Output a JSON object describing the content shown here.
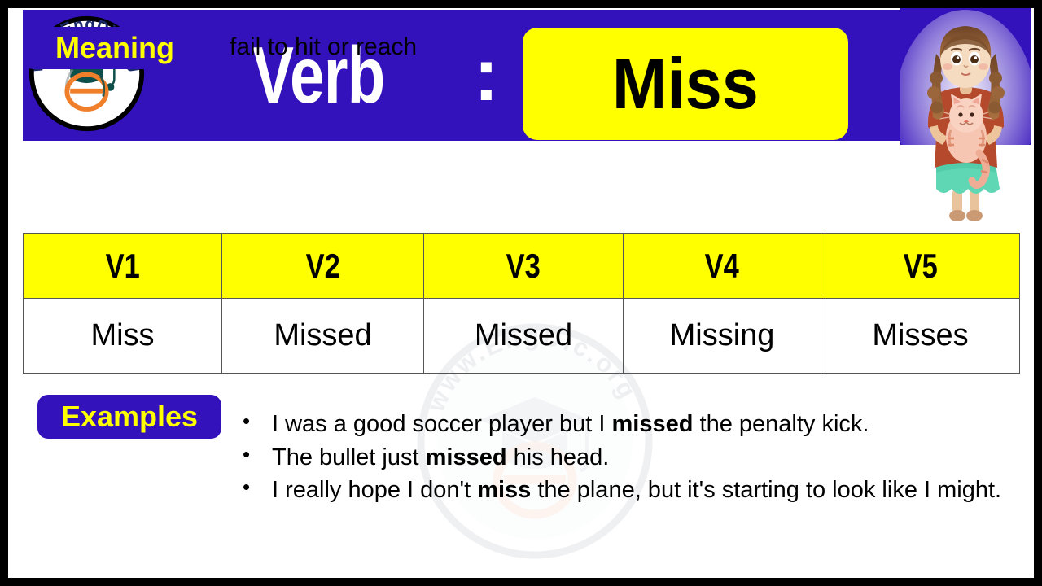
{
  "colors": {
    "brand_blue": "#3311BB",
    "accent_yellow": "#FFFF00",
    "text_black": "#000000",
    "border_black": "#000000",
    "table_grid": "#555555"
  },
  "logo": {
    "icon": "engdic-logo-icon",
    "text": "www.EngDic.org",
    "cap_color": "#0d4f4a",
    "e_color": "#ef7f2a"
  },
  "header": {
    "label": "Verb",
    "separator": ":",
    "verb": "Miss"
  },
  "illustration": {
    "icon": "girl-holding-cat-illustration",
    "description": "girl with curly brown hair holding a striped cat",
    "hair_color": "#8a5a33",
    "top_color": "#b5492c",
    "skirt_color": "#5fd6b4",
    "cat_color": "#f3b9a5"
  },
  "meaning": {
    "label": "Meaning",
    "text": "fail to hit or reach"
  },
  "table": {
    "headers": [
      "V1",
      "V2",
      "V3",
      "V4",
      "V5"
    ],
    "rows": [
      [
        "Miss",
        "Missed",
        "Missed",
        "Missing",
        "Misses"
      ]
    ]
  },
  "examples": {
    "label": "Examples",
    "items": [
      {
        "before": "I was a good soccer player but I ",
        "bold": "missed",
        "after": " the penalty kick."
      },
      {
        "before": "The bullet just ",
        "bold": "missed",
        "after": " his head."
      },
      {
        "before": "I really hope I don't ",
        "bold": "miss",
        "after": " the plane, but it's starting to look like I might."
      }
    ]
  },
  "watermark": {
    "icon": "engdic-watermark-icon",
    "text": "www.EngDic.org"
  }
}
